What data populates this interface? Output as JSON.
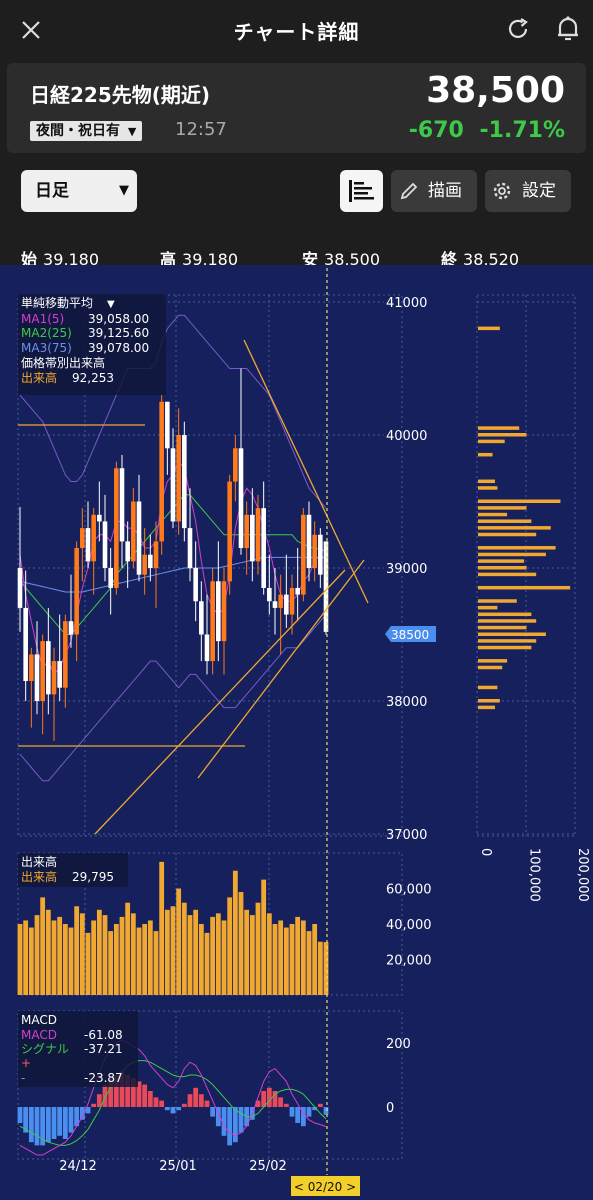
{
  "header": {
    "title": "チャート詳細"
  },
  "quote": {
    "symbol": "日経225先物(期近)",
    "session": "夜間・祝日有",
    "time": "12:57",
    "price": "38,500",
    "change": "-670",
    "change_pct": "-1.71%"
  },
  "toolbar": {
    "period": "日足",
    "draw_label": "描画",
    "settings_label": "設定"
  },
  "ohlc": {
    "open_label": "始",
    "open": "39,180",
    "high_label": "高",
    "high": "39,180",
    "low_label": "安",
    "low": "38,500",
    "close_label": "終",
    "close": "38,520"
  },
  "colors": {
    "bg": "#1e1e1e",
    "chart_bg": "#15205c",
    "up": "#ff7a1a",
    "down": "#ffffff",
    "accent": "#3ec94a",
    "vol": "#f0a830"
  },
  "ma_legend": {
    "title": "単純移動平均",
    "ma1_label": "MA1(5)",
    "ma1_value": "39,058.00",
    "ma2_label": "MA2(25)",
    "ma2_value": "39,125.60",
    "ma3_label": "MA3(75)",
    "ma3_value": "39,078.00",
    "profile_title": "価格帯別出来高",
    "profile_vol_label": "出来高",
    "profile_vol_value": "92,253"
  },
  "vol_legend": {
    "title": "出来高",
    "label": "出来高",
    "value": "29,795"
  },
  "macd_legend": {
    "title": "MACD",
    "macd_label": "MACD",
    "macd_value": "-61.08",
    "signal_label": "シグナル",
    "signal_value": "-37.21",
    "plus_label": "+",
    "minus_label": "-",
    "hist_value": "-23.87"
  },
  "price_axis": [
    "41000",
    "40000",
    "39000",
    "38000",
    "37000"
  ],
  "current_price_tag": "38500",
  "vol_axis": [
    "60,000",
    "40,000",
    "20,000"
  ],
  "macd_axis": [
    "200",
    "0"
  ],
  "profile_axis": [
    "0",
    "100,000",
    "200,000"
  ],
  "date_axis": [
    "24/12",
    "25/01",
    "25/02"
  ],
  "cursor_date": "< 02/20 >",
  "chart_data": {
    "type": "candlestick",
    "ylim": [
      37000,
      41000
    ],
    "candles": [
      [
        39000,
        39460,
        38520,
        38700
      ],
      [
        38700,
        38980,
        38000,
        38150
      ],
      [
        38150,
        38400,
        37800,
        38350
      ],
      [
        38350,
        38600,
        37900,
        38000
      ],
      [
        38000,
        38500,
        37750,
        38450
      ],
      [
        38450,
        38700,
        37900,
        38050
      ],
      [
        38050,
        38400,
        37700,
        38300
      ],
      [
        38300,
        38650,
        38000,
        38100
      ],
      [
        38100,
        38650,
        37950,
        38600
      ],
      [
        38600,
        38950,
        38400,
        38500
      ],
      [
        38500,
        39200,
        38300,
        39150
      ],
      [
        39150,
        39450,
        38900,
        39300
      ],
      [
        39300,
        39500,
        39000,
        39050
      ],
      [
        39050,
        39450,
        38800,
        39400
      ],
      [
        39400,
        39650,
        39200,
        39350
      ],
      [
        39350,
        39550,
        38900,
        39000
      ],
      [
        39000,
        39150,
        38650,
        38850
      ],
      [
        38850,
        39800,
        38800,
        39750
      ],
      [
        39750,
        39850,
        39000,
        39200
      ],
      [
        39200,
        39350,
        38850,
        39050
      ],
      [
        39050,
        39600,
        39000,
        39500
      ],
      [
        39500,
        39700,
        38900,
        38950
      ],
      [
        38950,
        39300,
        38800,
        39100
      ],
      [
        39100,
        39250,
        38900,
        39000
      ],
      [
        39000,
        39350,
        38700,
        39200
      ],
      [
        39200,
        40300,
        39100,
        40250
      ],
      [
        40250,
        40250,
        39700,
        39900
      ],
      [
        39900,
        40050,
        39300,
        39350
      ],
      [
        39350,
        40200,
        39250,
        40000
      ],
      [
        40000,
        40100,
        39200,
        39300
      ],
      [
        39300,
        39600,
        38900,
        39000
      ],
      [
        39000,
        39200,
        38600,
        38750
      ],
      [
        38750,
        38900,
        38300,
        38500
      ],
      [
        38500,
        38800,
        38200,
        38300
      ],
      [
        38300,
        39000,
        38200,
        38900
      ],
      [
        38900,
        39200,
        38300,
        38450
      ],
      [
        38450,
        39000,
        38200,
        38900
      ],
      [
        38900,
        39700,
        38800,
        39650
      ],
      [
        39650,
        40000,
        39500,
        39900
      ],
      [
        39900,
        40500,
        39100,
        39150
      ],
      [
        39150,
        39500,
        38950,
        39400
      ],
      [
        39400,
        39600,
        38900,
        39050
      ],
      [
        39050,
        39550,
        38950,
        39450
      ],
      [
        39450,
        39650,
        38800,
        38850
      ],
      [
        38850,
        39100,
        38650,
        38750
      ],
      [
        38750,
        39000,
        38500,
        38700
      ],
      [
        38700,
        38950,
        38350,
        38800
      ],
      [
        38800,
        39100,
        38550,
        38650
      ],
      [
        38650,
        38950,
        38500,
        38850
      ],
      [
        38850,
        39150,
        38600,
        38800
      ],
      [
        38800,
        39450,
        38750,
        39400
      ],
      [
        39400,
        39500,
        38900,
        39000
      ],
      [
        39000,
        39350,
        38900,
        39250
      ],
      [
        39250,
        39300,
        38850,
        38950
      ],
      [
        39200,
        39200,
        38500,
        38520
      ]
    ],
    "volume_ylim": [
      0,
      80000
    ],
    "volume": [
      40000,
      42000,
      38000,
      45000,
      55000,
      48000,
      42000,
      44000,
      40000,
      38000,
      50000,
      46000,
      35000,
      42000,
      48000,
      45000,
      36000,
      40000,
      44000,
      52000,
      46000,
      38000,
      40000,
      42000,
      36000,
      75000,
      48000,
      50000,
      60000,
      52000,
      45000,
      48000,
      40000,
      35000,
      44000,
      46000,
      42000,
      55000,
      70000,
      58000,
      48000,
      45000,
      52000,
      65000,
      46000,
      40000,
      42000,
      38000,
      40000,
      44000,
      42000,
      36000,
      40000,
      30000,
      29795
    ],
    "macd_ylim": [
      -300,
      300
    ],
    "macd_hist": [
      -50,
      -80,
      -110,
      -120,
      -120,
      -110,
      -100,
      -90,
      -100,
      -80,
      -60,
      -40,
      -20,
      10,
      40,
      70,
      90,
      100,
      110,
      100,
      90,
      80,
      70,
      50,
      30,
      20,
      -10,
      -20,
      -10,
      10,
      40,
      60,
      40,
      20,
      -30,
      -60,
      -90,
      -120,
      -110,
      -80,
      -60,
      -40,
      20,
      50,
      60,
      50,
      30,
      10,
      -30,
      -50,
      -60,
      -30,
      -10,
      10,
      -24
    ],
    "macd_line": [
      -120,
      -130,
      -140,
      -150,
      -150,
      -140,
      -130,
      -120,
      -110,
      -90,
      -60,
      -30,
      10,
      60,
      110,
      150,
      180,
      200,
      210,
      200,
      190,
      180,
      160,
      130,
      110,
      90,
      70,
      60,
      80,
      120,
      140,
      130,
      100,
      60,
      20,
      -20,
      -60,
      -80,
      -90,
      -80,
      -60,
      -20,
      30,
      80,
      110,
      120,
      100,
      80,
      40,
      10,
      -20,
      -40,
      -50,
      -55,
      -61
    ],
    "signal_line": [
      -60,
      -70,
      -80,
      -90,
      -100,
      -110,
      -115,
      -120,
      -120,
      -115,
      -105,
      -90,
      -70,
      -40,
      -10,
      30,
      60,
      90,
      110,
      130,
      140,
      145,
      145,
      140,
      130,
      120,
      110,
      100,
      95,
      95,
      100,
      100,
      95,
      85,
      70,
      50,
      30,
      10,
      -10,
      -20,
      -30,
      -30,
      -20,
      0,
      20,
      40,
      50,
      55,
      55,
      50,
      40,
      20,
      0,
      -20,
      -37
    ],
    "ma1": [
      39100,
      38800,
      38600,
      38400,
      38250,
      38300,
      38200,
      38250,
      38350,
      38450,
      38650,
      38850,
      39000,
      39200,
      39250,
      39250,
      39200,
      39350,
      39350,
      39300,
      39300,
      39250,
      39150,
      39150,
      39200,
      39500,
      39650,
      39700,
      39800,
      39750,
      39550,
      39350,
      39050,
      38800,
      38700,
      38650,
      38700,
      38950,
      39300,
      39500,
      39600,
      39550,
      39450,
      39300,
      39150,
      38950,
      38800,
      38750,
      38750,
      38800,
      38900,
      38950,
      39050,
      39100,
      39058
    ],
    "ma2": [
      38900,
      38850,
      38800,
      38750,
      38700,
      38650,
      38600,
      38550,
      38500,
      38500,
      38550,
      38600,
      38650,
      38700,
      38750,
      38800,
      38850,
      38950,
      39000,
      39050,
      39100,
      39150,
      39200,
      39250,
      39300,
      39350,
      39400,
      39450,
      39500,
      39550,
      39550,
      39500,
      39450,
      39400,
      39350,
      39300,
      39250,
      39250,
      39250,
      39250,
      39250,
      39250,
      39250,
      39250,
      39250,
      39250,
      39250,
      39250,
      39250,
      39200,
      39180,
      39160,
      39150,
      39140,
      39126
    ],
    "ma3": [
      38900,
      38890,
      38880,
      38870,
      38860,
      38850,
      38840,
      38830,
      38820,
      38820,
      38820,
      38820,
      38830,
      38840,
      38850,
      38860,
      38870,
      38880,
      38890,
      38900,
      38910,
      38920,
      38930,
      38940,
      38950,
      38960,
      38970,
      38980,
      38990,
      39000,
      39000,
      39000,
      39000,
      39000,
      39000,
      39000,
      39010,
      39020,
      39030,
      39040,
      39050,
      39060,
      39070,
      39080,
      39080,
      39080,
      39080,
      39080,
      39080,
      39080,
      39080,
      39080,
      39080,
      39080,
      39078
    ],
    "bb_upper": [
      40300,
      40250,
      40200,
      40150,
      40100,
      40000,
      39900,
      39800,
      39700,
      39650,
      39650,
      39700,
      39800,
      39900,
      40000,
      40100,
      40200,
      40300,
      40400,
      40500,
      40500,
      40500,
      40500,
      40500,
      40550,
      40700,
      40800,
      40850,
      40900,
      40900,
      40850,
      40800,
      40750,
      40700,
      40650,
      40600,
      40550,
      40500,
      40500,
      40500,
      40500,
      40450,
      40400,
      40350,
      40300,
      40200,
      40100,
      40000,
      39900,
      39800,
      39700,
      39600,
      39550,
      39500,
      39450
    ],
    "bb_lower": [
      37600,
      37550,
      37500,
      37450,
      37400,
      37400,
      37450,
      37500,
      37550,
      37600,
      37650,
      37700,
      37750,
      37800,
      37850,
      37900,
      37950,
      38000,
      38050,
      38100,
      38150,
      38200,
      38250,
      38300,
      38300,
      38250,
      38200,
      38150,
      38100,
      38150,
      38200,
      38200,
      38150,
      38100,
      38050,
      38000,
      37950,
      37950,
      37950,
      38000,
      38050,
      38100,
      38150,
      38200,
      38250,
      38300,
      38350,
      38400,
      38400,
      38400,
      38450,
      38500,
      38550,
      38600,
      38650
    ],
    "profile_xlim": [
      0,
      200000
    ],
    "profile": [
      {
        "price": 40800,
        "volume": 45000
      },
      {
        "price": 40050,
        "volume": 85000
      },
      {
        "price": 40000,
        "volume": 100000
      },
      {
        "price": 39950,
        "volume": 55000
      },
      {
        "price": 39850,
        "volume": 30000
      },
      {
        "price": 39650,
        "volume": 35000
      },
      {
        "price": 39600,
        "volume": 40000
      },
      {
        "price": 39500,
        "volume": 170000
      },
      {
        "price": 39450,
        "volume": 100000
      },
      {
        "price": 39400,
        "volume": 60000
      },
      {
        "price": 39350,
        "volume": 110000
      },
      {
        "price": 39300,
        "volume": 150000
      },
      {
        "price": 39250,
        "volume": 120000
      },
      {
        "price": 39150,
        "volume": 160000
      },
      {
        "price": 39100,
        "volume": 140000
      },
      {
        "price": 39050,
        "volume": 95000
      },
      {
        "price": 39000,
        "volume": 100000
      },
      {
        "price": 38950,
        "volume": 120000
      },
      {
        "price": 38850,
        "volume": 190000
      },
      {
        "price": 38750,
        "volume": 80000
      },
      {
        "price": 38700,
        "volume": 40000
      },
      {
        "price": 38650,
        "volume": 110000
      },
      {
        "price": 38600,
        "volume": 120000
      },
      {
        "price": 38550,
        "volume": 100000
      },
      {
        "price": 38500,
        "volume": 140000
      },
      {
        "price": 38450,
        "volume": 120000
      },
      {
        "price": 38400,
        "volume": 110000
      },
      {
        "price": 38300,
        "volume": 60000
      },
      {
        "price": 38250,
        "volume": 50000
      },
      {
        "price": 38100,
        "volume": 40000
      },
      {
        "price": 38000,
        "volume": 45000
      },
      {
        "price": 37950,
        "volume": 35000
      }
    ]
  }
}
